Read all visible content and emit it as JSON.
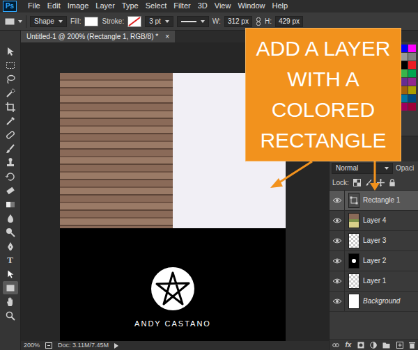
{
  "app": {
    "logo": "Ps"
  },
  "menu": [
    "File",
    "Edit",
    "Image",
    "Layer",
    "Type",
    "Select",
    "Filter",
    "3D",
    "View",
    "Window",
    "Help"
  ],
  "options_bar": {
    "mode": "Shape",
    "fill_label": "Fill:",
    "stroke_label": "Stroke:",
    "stroke_width": "3 pt",
    "width_label": "W:",
    "width": "312 px",
    "height_label": "H:",
    "height": "429 px"
  },
  "document_tab": {
    "title": "Untitled-1 @ 200% (Rectangle 1, RGB/8) *",
    "close": "×",
    "selected": true
  },
  "tools": [
    {
      "kind": "move",
      "selected": false
    },
    {
      "kind": "marquee",
      "selected": false
    },
    {
      "kind": "lasso",
      "selected": false
    },
    {
      "kind": "quick-select",
      "selected": false
    },
    {
      "kind": "crop",
      "selected": false
    },
    {
      "kind": "eyedropper",
      "selected": false
    },
    {
      "kind": "healing",
      "selected": false
    },
    {
      "kind": "brush",
      "selected": false
    },
    {
      "kind": "stamp",
      "selected": false
    },
    {
      "kind": "history-brush",
      "selected": false
    },
    {
      "kind": "eraser",
      "selected": false
    },
    {
      "kind": "gradient",
      "selected": false
    },
    {
      "kind": "blur",
      "selected": false
    },
    {
      "kind": "dodge",
      "selected": false
    },
    {
      "kind": "pen",
      "selected": false
    },
    {
      "kind": "type",
      "label": "T",
      "selected": false
    },
    {
      "kind": "path-select",
      "selected": false
    },
    {
      "kind": "rectangle",
      "selected": true
    },
    {
      "kind": "hand",
      "selected": false
    },
    {
      "kind": "zoom",
      "selected": false
    }
  ],
  "canvas": {
    "caption": "ANDY CASTANO"
  },
  "swatches": [
    {
      "color": "#ff0000"
    },
    {
      "color": "#ffff00"
    },
    {
      "color": "#00ff00"
    },
    {
      "color": "#00ffff"
    },
    {
      "color": "#0000ff"
    },
    {
      "color": "#ff00ff"
    },
    {
      "color": "#ffffff"
    },
    {
      "color": "#e6e6e6"
    },
    {
      "color": "#cccccc"
    },
    {
      "color": "#b3b3b3"
    },
    {
      "color": "#999999"
    },
    {
      "color": "#808080"
    },
    {
      "color": "#666666"
    },
    {
      "color": "#4d4d4d"
    },
    {
      "color": "#333333"
    },
    {
      "color": "#1a1a1a"
    },
    {
      "color": "#000000"
    },
    {
      "color": "#ed1c24"
    },
    {
      "color": "#f26c4f"
    },
    {
      "color": "#f7941d"
    },
    {
      "color": "#fff200"
    },
    {
      "color": "#8dc63f"
    },
    {
      "color": "#39b54a"
    },
    {
      "color": "#00a651"
    },
    {
      "color": "#00a99d"
    },
    {
      "color": "#00aeef"
    },
    {
      "color": "#0072bc"
    },
    {
      "color": "#2e3192"
    },
    {
      "color": "#662d91"
    },
    {
      "color": "#92278f"
    },
    {
      "color": "#ec008c"
    },
    {
      "color": "#ed145b"
    },
    {
      "color": "#9e0b0f"
    },
    {
      "color": "#a0410d"
    },
    {
      "color": "#a36209"
    },
    {
      "color": "#aba000"
    },
    {
      "color": "#598527"
    },
    {
      "color": "#1a7b30"
    },
    {
      "color": "#007236"
    },
    {
      "color": "#00746b"
    },
    {
      "color": "#0076a3"
    },
    {
      "color": "#004a80"
    },
    {
      "color": "#003471"
    },
    {
      "color": "#1b1464"
    },
    {
      "color": "#440e62"
    },
    {
      "color": "#630460"
    },
    {
      "color": "#9e005d"
    },
    {
      "color": "#9e0039"
    }
  ],
  "layers_panel": {
    "blend_mode": "Normal",
    "opacity_label": "Opaci",
    "lock_label": "Lock:",
    "fx_label": "fx"
  },
  "layers": [
    {
      "name": "Rectangle 1",
      "kind": "shape",
      "selected": true,
      "visible": true
    },
    {
      "name": "Layer 4",
      "kind": "photo",
      "selected": false,
      "visible": true
    },
    {
      "name": "Layer 3",
      "kind": "empty",
      "selected": false,
      "visible": true
    },
    {
      "name": "Layer 2",
      "kind": "logo",
      "selected": false,
      "visible": true
    },
    {
      "name": "Layer 1",
      "kind": "empty",
      "selected": false,
      "visible": true
    },
    {
      "name": "Background",
      "kind": "background",
      "selected": false,
      "visible": true
    }
  ],
  "status_bar": {
    "zoom": "200%",
    "doc": "Doc: 3.11M/7.45M"
  },
  "callout": {
    "lines": [
      "ADD A LAYER",
      "WITH A",
      "COLORED",
      "RECTANGLE"
    ]
  }
}
